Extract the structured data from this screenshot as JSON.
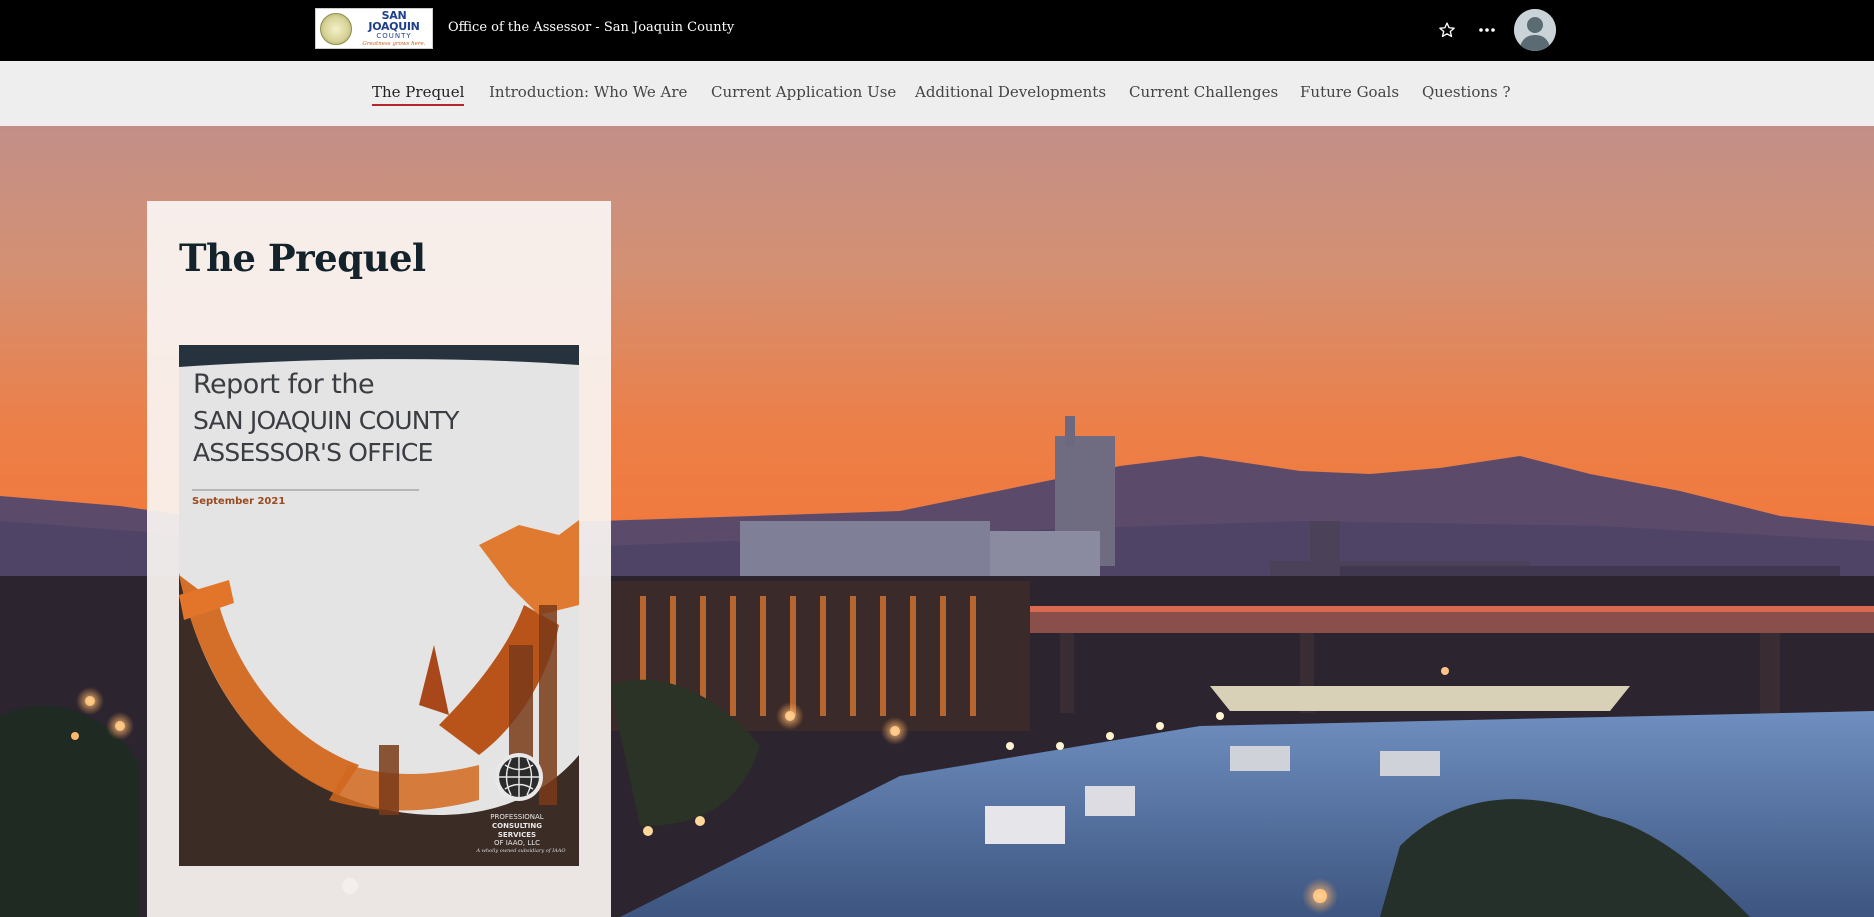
{
  "header": {
    "logo": {
      "main_text": "SAN JOAQUIN",
      "sub_text": "COUNTY",
      "tagline": "Greatness grows here."
    },
    "site_title": "Office of the Assessor - San Joaquin County",
    "icons": [
      "star-icon",
      "more-icon",
      "avatar"
    ]
  },
  "nav": {
    "items": [
      {
        "label": "The Prequel",
        "active": true
      },
      {
        "label": "Introduction: Who We Are",
        "active": false
      },
      {
        "label": "Current Application Use",
        "active": false
      },
      {
        "label": "Additional Developments",
        "active": false
      },
      {
        "label": "Current Challenges",
        "active": false
      },
      {
        "label": "Future Goals",
        "active": false
      },
      {
        "label": "Questions ?",
        "active": false
      }
    ],
    "active_color": "#b3272b"
  },
  "main": {
    "section_title": "The Prequel",
    "report_cover": {
      "line1": "Report for the",
      "line2": "SAN JOAQUIN COUNTY",
      "line3": "ASSESSOR'S OFFICE",
      "date": "September 2021",
      "org_line1": "PROFESSIONAL",
      "org_line2": "CONSULTING SERVICES",
      "org_line3": "OF IAAO, LLC",
      "org_subtitle": "A wholly owned subsidiary of IAAO"
    }
  },
  "colors": {
    "topbar": "#000000",
    "navbar": "#eeeeee",
    "sky_top": "#c28f88",
    "sky_glow": "#f07a3e",
    "card": "#faf4f2",
    "title_text": "#14232b",
    "accent_orange": "#d2681f"
  }
}
